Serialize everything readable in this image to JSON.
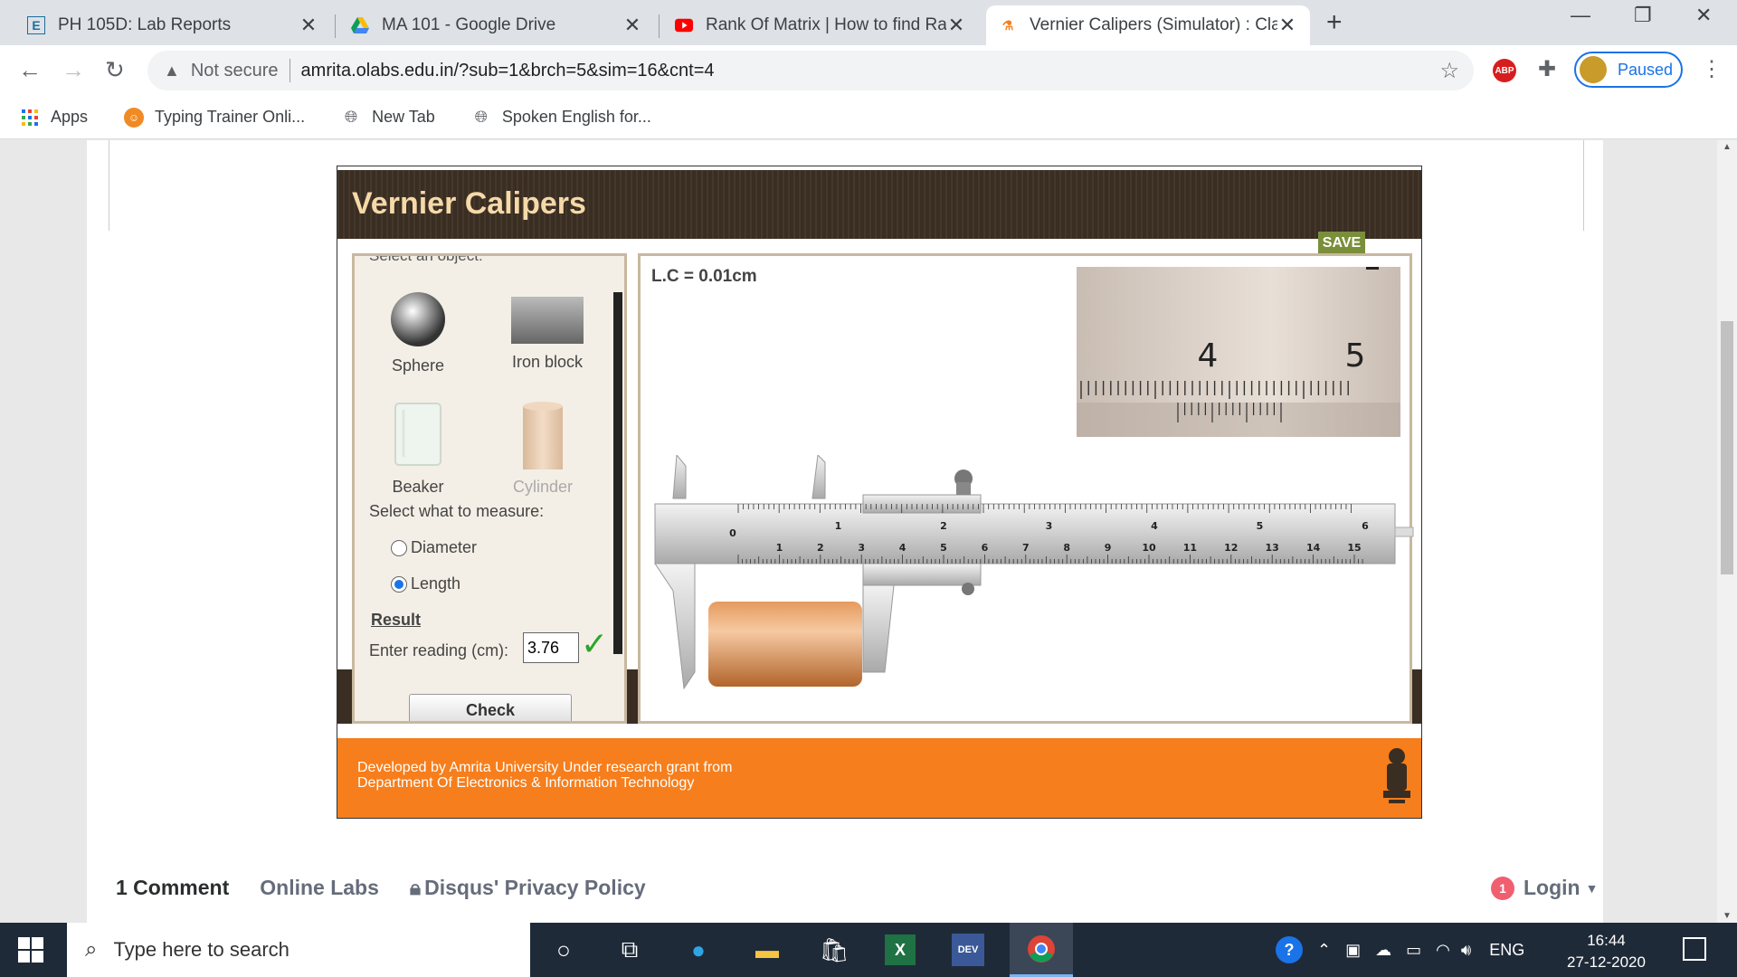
{
  "tabs": [
    {
      "label": "PH 105D: Lab Reports",
      "icon": "E"
    },
    {
      "label": "MA 101 - Google Drive",
      "icon": "drive"
    },
    {
      "label": "Rank Of Matrix | How to find Ran",
      "icon": "youtube"
    },
    {
      "label": "Vernier Calipers (Simulator) : Clas",
      "icon": "olabs"
    }
  ],
  "toolbar": {
    "security": "Not secure",
    "url": "amrita.olabs.edu.in/?sub=1&brch=5&sim=16&cnt=4",
    "profile_label": "Paused",
    "abp": "ABP"
  },
  "bookmarks": [
    {
      "label": "Apps"
    },
    {
      "label": "Typing Trainer Onli..."
    },
    {
      "label": "New Tab"
    },
    {
      "label": "Spoken English for..."
    }
  ],
  "sim": {
    "title": "Vernier Calipers",
    "save": "SAVE",
    "select_object_partial": "Select an object:",
    "objects": [
      {
        "label": "Sphere"
      },
      {
        "label": "Iron block"
      },
      {
        "label": "Beaker"
      },
      {
        "label": "Cylinder"
      }
    ],
    "measure_label": "Select what to measure:",
    "options": [
      {
        "label": "Diameter",
        "selected": false
      },
      {
        "label": "Length",
        "selected": true
      }
    ],
    "result_label": "Result",
    "reading_label": "Enter reading (cm):",
    "reading_value": "3.76",
    "check_label": "Check",
    "lc": "L.C = 0.01cm",
    "zoom_numbers": [
      "4",
      "5"
    ],
    "main_scale": [
      "0",
      "1",
      "2",
      "3",
      "4",
      "5",
      "6",
      "7",
      "8",
      "9",
      "10",
      "11",
      "12",
      "13",
      "14",
      "15"
    ],
    "vernier_scale": [
      "0",
      "1",
      "2",
      "3",
      "4",
      "5",
      "6"
    ],
    "footer_line1": "Developed by Amrita University Under research grant from",
    "footer_line2": "Department Of Electronics & Information Technology"
  },
  "comments": {
    "count": "1 Comment",
    "site": "Online Labs",
    "privacy": "Disqus' Privacy Policy",
    "login": "Login",
    "badge": "1"
  },
  "taskbar": {
    "search_placeholder": "Type here to search",
    "lang": "ENG",
    "time": "16:44",
    "date": "27-12-2020"
  }
}
